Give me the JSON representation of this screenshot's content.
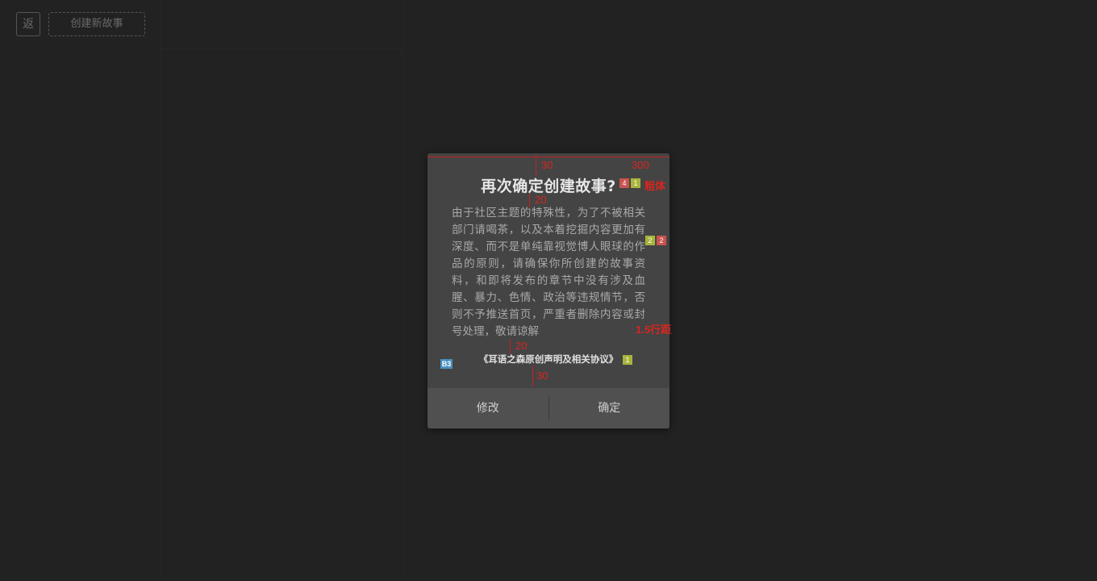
{
  "toolbar": {
    "back_label": "返",
    "create_label": "创建新故事"
  },
  "dialog": {
    "title": "再次确定创建故事?",
    "body": "由于社区主题的特殊性，为了不被相关部门请喝茶，以及本着挖掘内容更加有深度、而不是单纯靠视觉博人眼球的作品的原则，请确保你所创建的故事资料，和即将发布的章节中没有涉及血腥、暴力、色情、政治等违规情节，否则不予推送首页，严重者删除内容或封号处理，敬请谅解",
    "link": "《耳语之森原创声明及相关协议》",
    "modify_label": "修改",
    "confirm_label": "确定"
  },
  "annotations": {
    "top_padding": "30",
    "width": "300",
    "title_gap": "20",
    "bold_note": "粗体",
    "title_badge_a": "4",
    "title_badge_b": "1",
    "body_badge_a": "2",
    "body_badge_b": "2",
    "line_height_note": "1.5行距",
    "link_gap": "20",
    "link_badge": "1",
    "left_badge": "B3",
    "bottom_padding": "30"
  },
  "colors": {
    "background": "#222222",
    "dialog": "#444444",
    "footer": "#505050",
    "annotation": "#d9251f"
  }
}
